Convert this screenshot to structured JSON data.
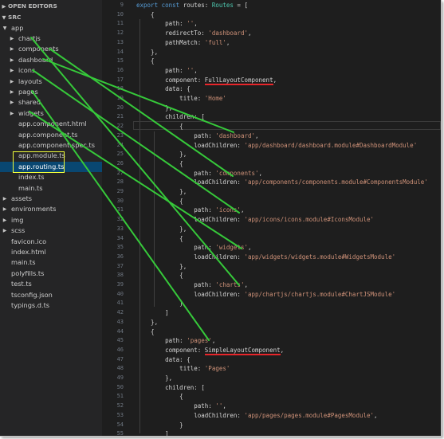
{
  "sidebar": {
    "open_editors_label": "OPEN EDITORS",
    "src_label": "SRC",
    "tree": [
      {
        "label": "app",
        "type": "folder",
        "expanded": true,
        "level": 0
      },
      {
        "label": "chartjs",
        "type": "folder",
        "expanded": false,
        "level": 1
      },
      {
        "label": "components",
        "type": "folder",
        "expanded": false,
        "level": 1
      },
      {
        "label": "dashboard",
        "type": "folder",
        "expanded": false,
        "level": 1
      },
      {
        "label": "icons",
        "type": "folder",
        "expanded": false,
        "level": 1
      },
      {
        "label": "layouts",
        "type": "folder",
        "expanded": false,
        "level": 1
      },
      {
        "label": "pages",
        "type": "folder",
        "expanded": false,
        "level": 1
      },
      {
        "label": "shared",
        "type": "folder",
        "expanded": false,
        "level": 1
      },
      {
        "label": "widgets",
        "type": "folder",
        "expanded": false,
        "level": 1
      },
      {
        "label": "app.component.html",
        "type": "file",
        "level": 1
      },
      {
        "label": "app.component.ts",
        "type": "file",
        "level": 1
      },
      {
        "label": "app.component.spec.ts",
        "type": "file",
        "level": 1
      },
      {
        "label": "app.module.ts",
        "type": "file",
        "level": 1,
        "highlighted": true
      },
      {
        "label": "app.routing.ts",
        "type": "file",
        "level": 1,
        "highlighted": true,
        "selected": true
      },
      {
        "label": "index.ts",
        "type": "file",
        "level": 1
      },
      {
        "label": "main.ts",
        "type": "file",
        "level": 1
      },
      {
        "label": "assets",
        "type": "folder",
        "expanded": false,
        "level": 0
      },
      {
        "label": "environments",
        "type": "folder",
        "expanded": false,
        "level": 0
      },
      {
        "label": "img",
        "type": "folder",
        "expanded": false,
        "level": 0
      },
      {
        "label": "scss",
        "type": "folder",
        "expanded": false,
        "level": 0
      },
      {
        "label": "favicon.ico",
        "type": "file",
        "level": 0
      },
      {
        "label": "index.html",
        "type": "file",
        "level": 0
      },
      {
        "label": "main.ts",
        "type": "file",
        "level": 0
      },
      {
        "label": "polyfills.ts",
        "type": "file",
        "level": 0
      },
      {
        "label": "test.ts",
        "type": "file",
        "level": 0
      },
      {
        "label": "tsconfig.json",
        "type": "file",
        "level": 0
      },
      {
        "label": "typings.d.ts",
        "type": "file",
        "level": 0
      }
    ]
  },
  "editor": {
    "lines": [
      {
        "num": "9",
        "tokens": [
          [
            "kw",
            "export const "
          ],
          [
            "plain",
            "routes: "
          ],
          [
            "typ",
            "Routes"
          ],
          [
            "plain",
            " = ["
          ]
        ]
      },
      {
        "num": "10",
        "tokens": [
          [
            "plain",
            "    {"
          ]
        ]
      },
      {
        "num": "11",
        "tokens": [
          [
            "plain",
            "        path: "
          ],
          [
            "str",
            "''"
          ],
          [
            "plain",
            ","
          ]
        ]
      },
      {
        "num": "12",
        "tokens": [
          [
            "plain",
            "        redirectTo: "
          ],
          [
            "str",
            "'dashboard'"
          ],
          [
            "plain",
            ","
          ]
        ]
      },
      {
        "num": "13",
        "tokens": [
          [
            "plain",
            "        pathMatch: "
          ],
          [
            "str",
            "'full'"
          ],
          [
            "plain",
            ","
          ]
        ]
      },
      {
        "num": "14",
        "tokens": [
          [
            "plain",
            "    },"
          ]
        ]
      },
      {
        "num": "15",
        "tokens": [
          [
            "plain",
            "    {"
          ]
        ]
      },
      {
        "num": "16",
        "tokens": [
          [
            "plain",
            "        path: "
          ],
          [
            "str",
            "''"
          ],
          [
            "plain",
            ","
          ]
        ]
      },
      {
        "num": "17",
        "tokens": [
          [
            "plain",
            "        component: "
          ],
          [
            "plain",
            "FullLayoutComponent"
          ],
          [
            "plain",
            ","
          ]
        ]
      },
      {
        "num": "18",
        "tokens": [
          [
            "plain",
            "        data: {"
          ]
        ]
      },
      {
        "num": "19",
        "tokens": [
          [
            "plain",
            "            title: "
          ],
          [
            "str",
            "'Home'"
          ]
        ]
      },
      {
        "num": "20",
        "tokens": [
          [
            "plain",
            "        },"
          ]
        ]
      },
      {
        "num": "21",
        "tokens": [
          [
            "plain",
            "        children: ["
          ]
        ]
      },
      {
        "num": "22",
        "tokens": [
          [
            "plain",
            "            {"
          ]
        ]
      },
      {
        "num": "23",
        "tokens": [
          [
            "plain",
            "                path: "
          ],
          [
            "str",
            "'dashboard'"
          ],
          [
            "plain",
            ","
          ]
        ]
      },
      {
        "num": "24",
        "tokens": [
          [
            "plain",
            "                loadChildren: "
          ],
          [
            "str",
            "'app/dashboard/dashboard.module#DashboardModule'"
          ]
        ]
      },
      {
        "num": "25",
        "tokens": [
          [
            "plain",
            "            },"
          ]
        ]
      },
      {
        "num": "26",
        "tokens": [
          [
            "plain",
            "            {"
          ]
        ]
      },
      {
        "num": "27",
        "tokens": [
          [
            "plain",
            "                path: "
          ],
          [
            "str",
            "'components'"
          ],
          [
            "plain",
            ","
          ]
        ]
      },
      {
        "num": "28",
        "tokens": [
          [
            "plain",
            "                loadChildren: "
          ],
          [
            "str",
            "'app/components/components.module#ComponentsModule'"
          ]
        ]
      },
      {
        "num": "29",
        "tokens": [
          [
            "plain",
            "            },"
          ]
        ]
      },
      {
        "num": "30",
        "tokens": [
          [
            "plain",
            "            {"
          ]
        ]
      },
      {
        "num": "31",
        "tokens": [
          [
            "plain",
            "                path: "
          ],
          [
            "str",
            "'icons'"
          ],
          [
            "plain",
            ","
          ]
        ]
      },
      {
        "num": "32",
        "tokens": [
          [
            "plain",
            "                loadChildren: "
          ],
          [
            "str",
            "'app/icons/icons.module#IconsModule'"
          ]
        ]
      },
      {
        "num": "33",
        "tokens": [
          [
            "plain",
            "            },"
          ]
        ]
      },
      {
        "num": "34",
        "tokens": [
          [
            "plain",
            "            {"
          ]
        ]
      },
      {
        "num": "35",
        "tokens": [
          [
            "plain",
            "                path: "
          ],
          [
            "str",
            "'widgets'"
          ],
          [
            "plain",
            ","
          ]
        ]
      },
      {
        "num": "36",
        "tokens": [
          [
            "plain",
            "                loadChildren: "
          ],
          [
            "str",
            "'app/widgets/widgets.module#WidgetsModule'"
          ]
        ]
      },
      {
        "num": "37",
        "tokens": [
          [
            "plain",
            "            },"
          ]
        ]
      },
      {
        "num": "38",
        "tokens": [
          [
            "plain",
            "            {"
          ]
        ]
      },
      {
        "num": "39",
        "tokens": [
          [
            "plain",
            "                path: "
          ],
          [
            "str",
            "'charts'"
          ],
          [
            "plain",
            ","
          ]
        ]
      },
      {
        "num": "40",
        "tokens": [
          [
            "plain",
            "                loadChildren: "
          ],
          [
            "str",
            "'app/chartjs/chartjs.module#ChartJSModule'"
          ]
        ]
      },
      {
        "num": "41",
        "tokens": [
          [
            "plain",
            "            }"
          ]
        ]
      },
      {
        "num": "42",
        "tokens": [
          [
            "plain",
            "        ]"
          ]
        ]
      },
      {
        "num": "43",
        "tokens": [
          [
            "plain",
            "    },"
          ]
        ]
      },
      {
        "num": "44",
        "tokens": [
          [
            "plain",
            "    {"
          ]
        ]
      },
      {
        "num": "45",
        "tokens": [
          [
            "plain",
            "        path: "
          ],
          [
            "str",
            "'pages'"
          ],
          [
            "plain",
            ","
          ]
        ]
      },
      {
        "num": "46",
        "tokens": [
          [
            "plain",
            "        component: "
          ],
          [
            "plain",
            "SimpleLayoutComponent"
          ],
          [
            "plain",
            ","
          ]
        ]
      },
      {
        "num": "47",
        "tokens": [
          [
            "plain",
            "        data: {"
          ]
        ]
      },
      {
        "num": "48",
        "tokens": [
          [
            "plain",
            "            title: "
          ],
          [
            "str",
            "'Pages'"
          ]
        ]
      },
      {
        "num": "49",
        "tokens": [
          [
            "plain",
            "        },"
          ]
        ]
      },
      {
        "num": "50",
        "tokens": [
          [
            "plain",
            "        children: ["
          ]
        ]
      },
      {
        "num": "51",
        "tokens": [
          [
            "plain",
            "            {"
          ]
        ]
      },
      {
        "num": "52",
        "tokens": [
          [
            "plain",
            "                path: "
          ],
          [
            "str",
            "''"
          ],
          [
            "plain",
            ","
          ]
        ]
      },
      {
        "num": "53",
        "tokens": [
          [
            "plain",
            "                loadChildren: "
          ],
          [
            "str",
            "'app/pages/pages.module#PagesModule'"
          ],
          [
            "plain",
            ","
          ]
        ]
      },
      {
        "num": "54",
        "tokens": [
          [
            "plain",
            "            }"
          ]
        ]
      },
      {
        "num": "55",
        "tokens": [
          [
            "plain",
            "        ]"
          ]
        ]
      }
    ]
  },
  "annotation_colors": {
    "arrows": "#36c93a",
    "highlight_box": "#f2ff3a",
    "underline": "#e8262b"
  }
}
